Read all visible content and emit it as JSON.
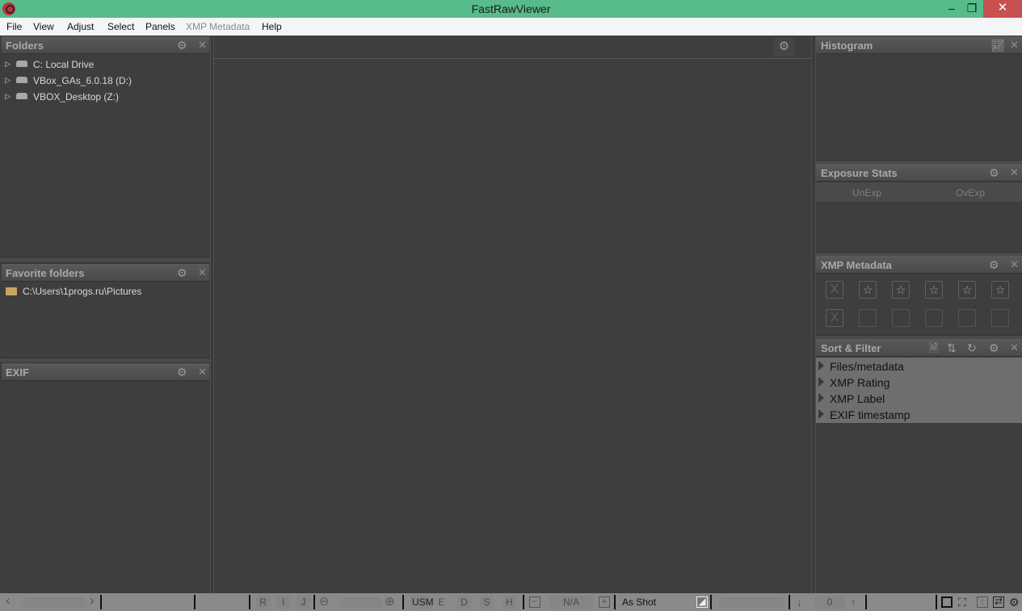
{
  "window": {
    "title": "FastRawViewer",
    "minimize_icon": "minimize-icon",
    "maximize_icon": "restore-icon",
    "close_icon": "close-icon"
  },
  "menu": {
    "items": [
      {
        "label": "File"
      },
      {
        "label": "View"
      },
      {
        "label": "Adjust"
      },
      {
        "label": "Select"
      },
      {
        "label": "Panels"
      },
      {
        "label": "XMP Metadata",
        "disabled": true
      },
      {
        "label": "Help"
      }
    ]
  },
  "folders_panel": {
    "title": "Folders",
    "items": [
      {
        "label": "C: Local Drive",
        "icon": "drive-icon"
      },
      {
        "label": "VBox_GAs_6.0.18 (D:)",
        "icon": "drive-icon"
      },
      {
        "label": "VBOX_Desktop (Z:)",
        "icon": "drive-icon"
      }
    ]
  },
  "favorites_panel": {
    "title": "Favorite folders",
    "items": [
      {
        "label": "C:\\Users\\1progs.ru\\Pictures",
        "icon": "folder-icon"
      }
    ]
  },
  "exif_panel": {
    "title": "EXIF"
  },
  "histogram_panel": {
    "title": "Histogram"
  },
  "exposure_panel": {
    "title": "Exposure Stats",
    "columns": [
      "UnExp",
      "OvExp"
    ]
  },
  "xmp_panel": {
    "title": "XMP Metadata",
    "rating_buttons": [
      "X",
      "☆",
      "☆",
      "☆",
      "☆",
      "☆"
    ],
    "label_buttons": [
      "X",
      "",
      "",
      "",
      "",
      ""
    ]
  },
  "sort_filter_panel": {
    "title": "Sort & Filter",
    "items": [
      {
        "label": "Files/metadata"
      },
      {
        "label": "XMP Rating"
      },
      {
        "label": "XMP Label"
      },
      {
        "label": "EXIF timestamp"
      }
    ]
  },
  "statusbar": {
    "prev": "‹",
    "next": "›",
    "raw_buttons": [
      "R",
      "I",
      "J"
    ],
    "sharpen_buttons": [
      "USM",
      "E",
      "D",
      "S",
      "H"
    ],
    "exposure_value": "N/A",
    "white_balance": "As Shot",
    "rotation_value": "0"
  },
  "colors": {
    "titlebar": "#57bb8a",
    "close_button": "#c75050",
    "panel_bg": "#3e3e3e",
    "statusbar_bg": "#8a8a8a",
    "sort_filter_bg": "#6e6e6e"
  }
}
